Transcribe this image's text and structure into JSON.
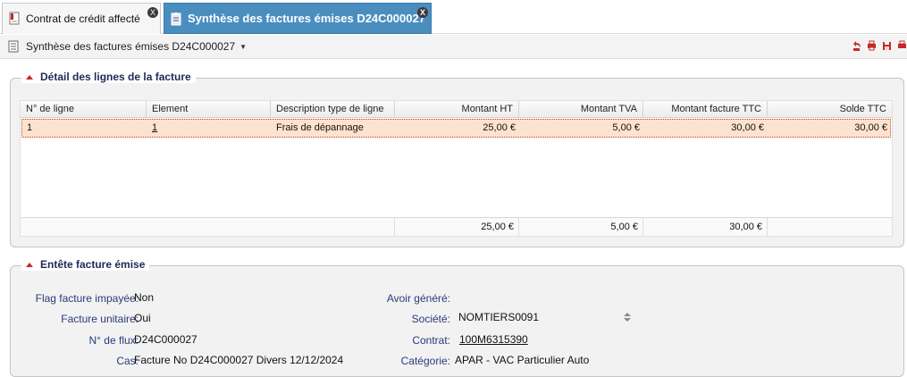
{
  "tabs": [
    {
      "label": "Contrat de crédit affecté",
      "icon": "document-icon",
      "close": "X"
    },
    {
      "label": "Synthèse des factures émises D24C000027",
      "icon": "clipboard-icon",
      "close": "X"
    }
  ],
  "toolbar": {
    "title": "Synthèse des factures émises D24C000027",
    "actions": [
      "back-icon",
      "print-icon",
      "save-icon",
      "print-icon"
    ]
  },
  "lines_panel": {
    "title": "Détail des lignes de la facture",
    "columns": [
      "N° de ligne",
      "Element",
      "Description type de ligne",
      "Montant HT",
      "Montant TVA",
      "Montant facture TTC",
      "Solde TTC"
    ],
    "rows": [
      {
        "line": "1",
        "element": "1",
        "description": "Frais de dépannage",
        "ht": "25,00 €",
        "tva": "5,00 €",
        "ttc": "30,00 €",
        "solde": "30,00 €"
      }
    ],
    "totals": {
      "ht": "25,00 €",
      "tva": "5,00 €",
      "ttc": "30,00 €"
    }
  },
  "header_panel": {
    "title": "Entête facture émise",
    "left": [
      {
        "label": "Flag facture impayée:",
        "value": "Non"
      },
      {
        "label": "Facture unitaire:",
        "value": "Oui"
      },
      {
        "label": "N° de flux:",
        "value": "D24C000027"
      },
      {
        "label": "Cas:",
        "value": "Facture No D24C000027 Divers 12/12/2024"
      }
    ],
    "right": [
      {
        "label": "Avoir généré:",
        "value": ""
      },
      {
        "label": "Société:",
        "value": "NOMTIERS0091"
      },
      {
        "label": "Contrat:",
        "value": "100M6315390"
      },
      {
        "label": "Catégorie:",
        "value": "APAR - VAC Particulier Auto"
      }
    ]
  },
  "colors": {
    "tab_active": "#4a8ec0",
    "selected_row": "#fde3cf",
    "label": "#2a3a7a",
    "accent_red": "#c62828"
  }
}
